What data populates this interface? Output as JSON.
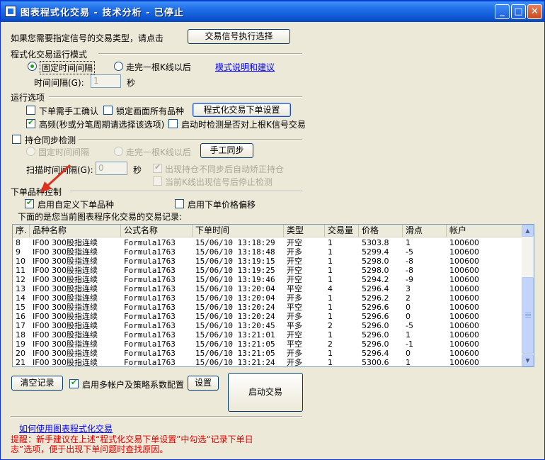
{
  "titlebar": {
    "title": "图表程式化交易 - 技术分析 - 已停止",
    "min_icon": "minimize-icon",
    "max_icon": "maximize-icon",
    "close_icon": "close-icon"
  },
  "signal": {
    "prompt": "如果您需要指定信号的交易类型，请点击",
    "button": "交易信号执行选择"
  },
  "mode": {
    "title": "程式化交易运行模式",
    "radio_fixed": "固定时间间隔",
    "radio_kline": "走完一根K线以后",
    "link": "模式说明和建议",
    "interval_label": "时间间隔(G):",
    "interval_value": "1",
    "interval_unit": "秒",
    "selected": "fixed"
  },
  "options": {
    "title": "运行选项",
    "manual_confirm": "下单需手工确认",
    "lock_all": "锁定画面所有品种",
    "order_settings_button": "程式化交易下单设置",
    "high_freq": "高频(秒或分笔周期请选择该选项)",
    "check_on_start": "启动时检测是否对上根K信号交易",
    "manual_confirm_checked": false,
    "lock_all_checked": false,
    "high_freq_checked": true,
    "check_on_start_checked": false
  },
  "sync": {
    "title": "持仓同步检测",
    "checked": false,
    "radio_fixed": "固定时间间隔",
    "radio_kline": "走完一根K线以后",
    "manual_sync_button": "手工同步",
    "scan_label": "扫描时间间隔(G):",
    "scan_value": "0",
    "scan_unit": "秒",
    "auto_fix": "出现持仓不同步后自动矫正持仓",
    "stop_check": "当前K线出现信号后停止检测"
  },
  "order": {
    "title": "下单品种控制",
    "custom_symbol": "启用自定义下单品种",
    "custom_symbol_checked": true,
    "price_offset": "启用下单价格偏移",
    "price_offset_checked": false
  },
  "records": {
    "caption": "下面的是您当前图表程序化交易的交易记录:",
    "columns": [
      "序.",
      "品种名称",
      "公式名称",
      "下单时间",
      "类型",
      "交易量",
      "价格",
      "滑点",
      "帐户"
    ],
    "rows": [
      [
        "8",
        "IF00 300股指连续",
        "Formula1763",
        "15/06/10 13:18:29",
        "开空",
        "1",
        "5303.8",
        "1",
        "100600"
      ],
      [
        "9",
        "IF00 300股指连续",
        "Formula1763",
        "15/06/10 13:18:48",
        "开多",
        "1",
        "5299.4",
        "-5",
        "100600"
      ],
      [
        "10",
        "IF00 300股指连续",
        "Formula1763",
        "15/06/10 13:19:15",
        "开空",
        "1",
        "5298.0",
        "-8",
        "100600"
      ],
      [
        "11",
        "IF00 300股指连续",
        "Formula1763",
        "15/06/10 13:19:25",
        "开空",
        "1",
        "5298.0",
        "-8",
        "100600"
      ],
      [
        "12",
        "IF00 300股指连续",
        "Formula1763",
        "15/06/10 13:19:46",
        "开空",
        "1",
        "5294.2",
        "-9",
        "100600"
      ],
      [
        "13",
        "IF00 300股指连续",
        "Formula1763",
        "15/06/10 13:20:04",
        "平空",
        "4",
        "5296.4",
        "3",
        "100600"
      ],
      [
        "14",
        "IF00 300股指连续",
        "Formula1763",
        "15/06/10 13:20:04",
        "开多",
        "1",
        "5296.2",
        "2",
        "100600"
      ],
      [
        "15",
        "IF00 300股指连续",
        "Formula1763",
        "15/06/10 13:20:24",
        "平空",
        "1",
        "5296.6",
        "0",
        "100600"
      ],
      [
        "16",
        "IF00 300股指连续",
        "Formula1763",
        "15/06/10 13:20:24",
        "开多",
        "1",
        "5296.6",
        "0",
        "100600"
      ],
      [
        "17",
        "IF00 300股指连续",
        "Formula1763",
        "15/06/10 13:20:45",
        "平多",
        "2",
        "5296.0",
        "-5",
        "100600"
      ],
      [
        "18",
        "IF00 300股指连续",
        "Formula1763",
        "15/06/10 13:21:01",
        "开空",
        "1",
        "5296.0",
        "1",
        "100600"
      ],
      [
        "19",
        "IF00 300股指连续",
        "Formula1763",
        "15/06/10 13:21:05",
        "平空",
        "2",
        "5296.0",
        "-1",
        "100600"
      ],
      [
        "20",
        "IF00 300股指连续",
        "Formula1763",
        "15/06/10 13:21:05",
        "开多",
        "1",
        "5296.4",
        "0",
        "100600"
      ],
      [
        "21",
        "IF00 300股指连续",
        "Formula1763",
        "15/06/10 13:21:24",
        "开多",
        "1",
        "5300.6",
        "1",
        "100600"
      ]
    ]
  },
  "bottom": {
    "clear_button": "清空记录",
    "multi_account": "启用多帐户及策略系数配置",
    "multi_account_checked": true,
    "settings_button": "设置",
    "start_button": "启动交易",
    "help_link": "如何使用图表程式化交易",
    "hint": "提醒：新手建议在上述“程式化交易下单设置”中勾选“记录下单日志”选项，便于出现下单问题时查找原因。"
  },
  "colors": {
    "titlebar": "#0b53d0",
    "window_bg": "#ece9d8",
    "link": "#0000ff",
    "hint": "#e00000",
    "annotation_arrow": "#e03020"
  }
}
